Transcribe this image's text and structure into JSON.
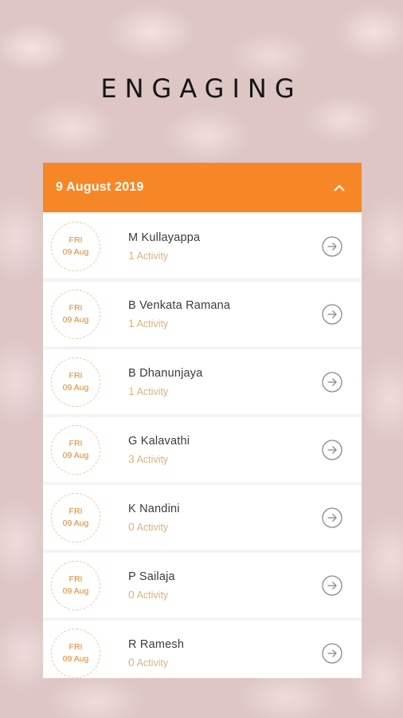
{
  "app": {
    "title": "ENGAGING"
  },
  "panel": {
    "date": "9 August 2019",
    "accent_color": "#f78726",
    "rows": [
      {
        "day": "FRI",
        "date": "09 Aug",
        "name": "M Kullayappa",
        "count": "1",
        "activity_label": "Activity"
      },
      {
        "day": "FRI",
        "date": "09 Aug",
        "name": "B Venkata Ramana",
        "count": "1",
        "activity_label": "Activity"
      },
      {
        "day": "FRI",
        "date": "09 Aug",
        "name": "B Dhanunjaya",
        "count": "1",
        "activity_label": "Activity"
      },
      {
        "day": "FRI",
        "date": "09 Aug",
        "name": "G Kalavathi",
        "count": "3",
        "activity_label": "Activity"
      },
      {
        "day": "FRI",
        "date": "09 Aug",
        "name": "K Nandini",
        "count": "0",
        "activity_label": "Activity"
      },
      {
        "day": "FRI",
        "date": "09 Aug",
        "name": "P Sailaja",
        "count": "0",
        "activity_label": "Activity"
      },
      {
        "day": "FRI",
        "date": "09 Aug",
        "name": "R Ramesh",
        "count": "0",
        "activity_label": "Activity"
      }
    ]
  }
}
